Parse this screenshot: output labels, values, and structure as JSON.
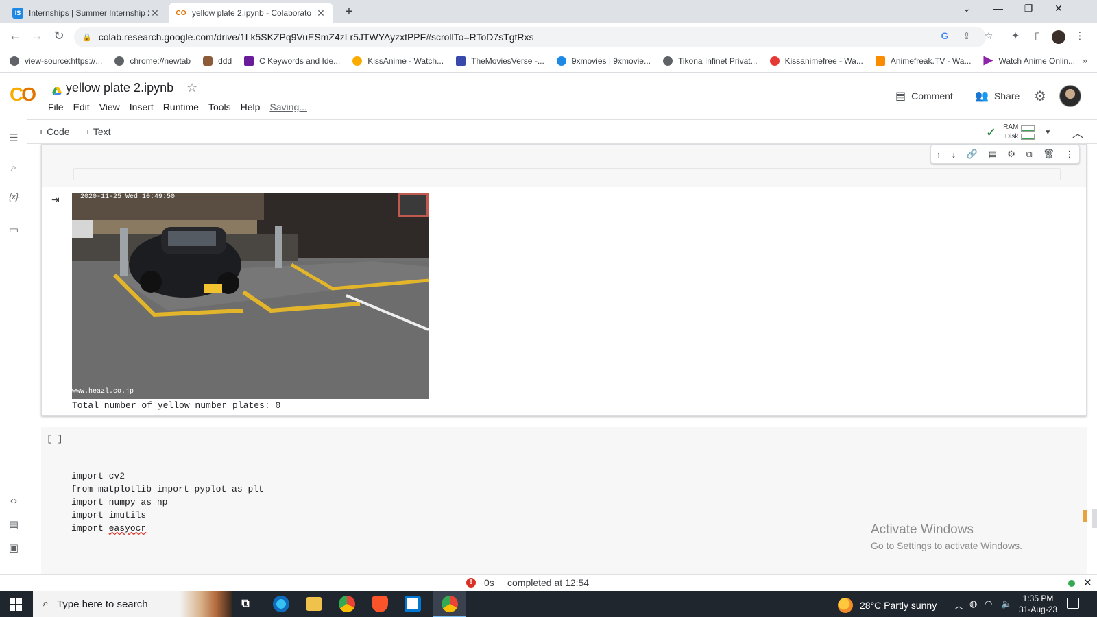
{
  "browser": {
    "tabs": [
      {
        "title": "Internships | Summer Internship 2",
        "favicon": "IS",
        "favicon_color": "#1e88e5",
        "active": false
      },
      {
        "title": "yellow plate 2.ipynb - Colaborato",
        "favicon": "CO",
        "favicon_color": "#e37400",
        "active": true
      }
    ],
    "url": "colab.research.google.com/drive/1Lk5SKZPq9VuESmZ4zLr5JTWYAyzxtPPF#scrollTo=RToD7sTgtRxs",
    "bookmarks": [
      {
        "label": "view-source:https://...",
        "color": "#5f6368"
      },
      {
        "label": "chrome://newtab",
        "color": "#5f6368"
      },
      {
        "label": "ddd",
        "color": "#8d5a3a"
      },
      {
        "label": "C Keywords and Ide...",
        "color": "#6a1b9a"
      },
      {
        "label": "KissAnime - Watch...",
        "color": "#f9ab00"
      },
      {
        "label": "TheMoviesVerse -...",
        "color": "#3949ab"
      },
      {
        "label": "9xmovies | 9xmovie...",
        "color": "#1e88e5"
      },
      {
        "label": "Tikona Infinet Privat...",
        "color": "#5f6368"
      },
      {
        "label": "Kissanimefree - Wa...",
        "color": "#e53935"
      },
      {
        "label": "Animefreak.TV - Wa...",
        "color": "#fb8c00"
      },
      {
        "label": "Watch Anime Onlin...",
        "color": "#8e24aa"
      }
    ]
  },
  "colab": {
    "notebook_title": "yellow plate 2.ipynb",
    "menu": [
      "File",
      "Edit",
      "View",
      "Insert",
      "Runtime",
      "Tools",
      "Help"
    ],
    "saving_label": "Saving...",
    "comment_label": "Comment",
    "share_label": "Share",
    "add_code_label": "+ Code",
    "add_text_label": "+ Text",
    "ram_label": "RAM",
    "disk_label": "Disk",
    "output": {
      "image_timestamp": "2020-11-25 Wed 10:49:50",
      "image_watermark": "www.heazl.co.jp",
      "text": "Total number of yellow number plates: 0"
    },
    "cell2": {
      "bracket": "[ ]",
      "code_lines": [
        "import cv2",
        "from matplotlib import pyplot as plt",
        "import numpy as np",
        "import imutils",
        "import "
      ],
      "squiggle_word": "easyocr"
    },
    "status": {
      "duration": "0s",
      "completed": "completed at 12:54"
    },
    "watermark": {
      "line1": "Activate Windows",
      "line2": "Go to Settings to activate Windows."
    }
  },
  "taskbar": {
    "search_placeholder": "Type here to search",
    "weather": "28°C  Partly sunny",
    "time": "1:35 PM",
    "date": "31-Aug-23"
  },
  "colors": {
    "accent": "#f9ab00",
    "error": "#d93025",
    "ok": "#34a853"
  }
}
